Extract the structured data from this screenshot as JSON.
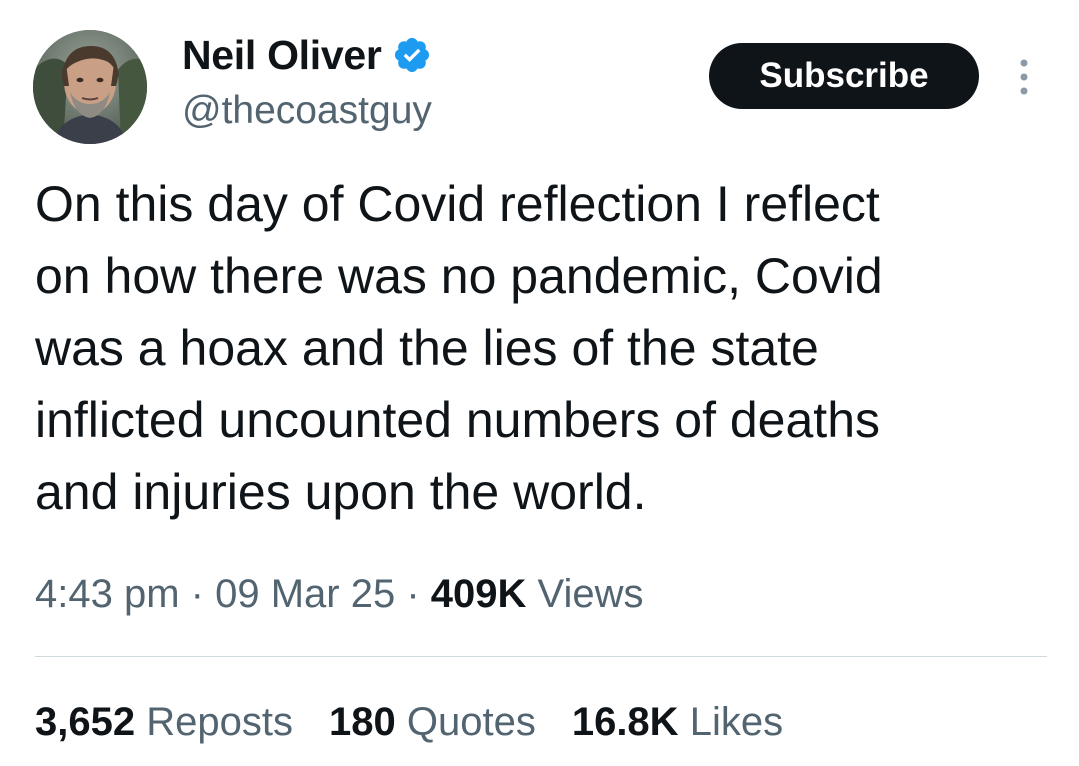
{
  "author": {
    "display_name": "Neil Oliver",
    "handle": "@thecoastguy",
    "verified": true,
    "verified_color": "#1d9bf0"
  },
  "actions": {
    "subscribe_label": "Subscribe",
    "more_icon": "more-vertical-icon"
  },
  "tweet": {
    "text": "On this day of Covid reflection I reflect\non how there was no pandemic, Covid\nwas a hoax and the lies of the state\ninflicted uncounted numbers of deaths\nand injuries upon the world."
  },
  "meta": {
    "time": "4:43 pm",
    "separator": "·",
    "date": "09 Mar 25",
    "views_count": "409K",
    "views_label": "Views"
  },
  "stats": {
    "reposts_count": "3,652",
    "reposts_label": "Reposts",
    "quotes_count": "180",
    "quotes_label": "Quotes",
    "likes_count": "16.8K",
    "likes_label": "Likes"
  },
  "colors": {
    "text_primary": "#0f1419",
    "text_secondary": "#536471",
    "divider": "#cfd9de",
    "button_bg": "#0f1419"
  }
}
